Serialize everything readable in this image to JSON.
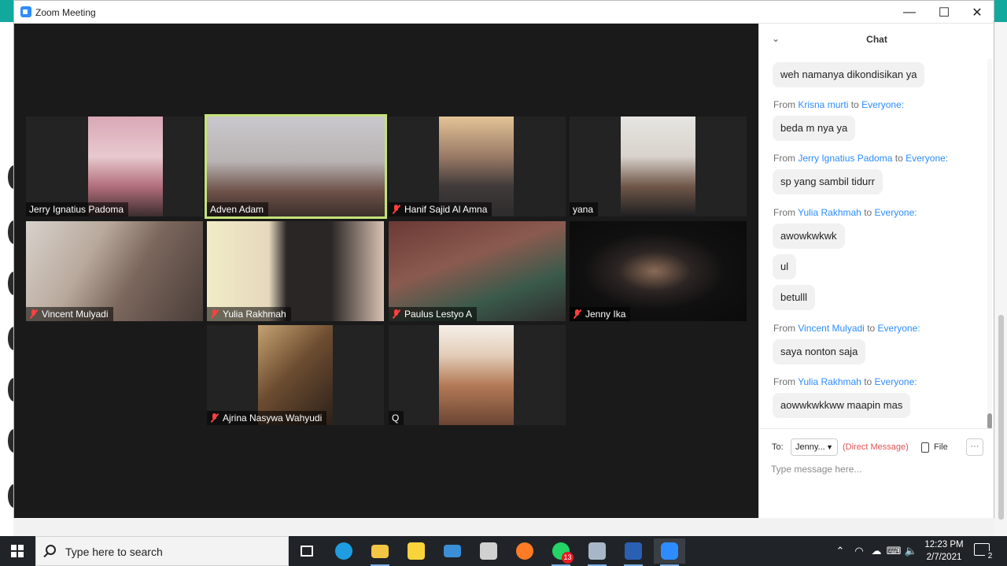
{
  "window": {
    "title": "Zoom Meeting",
    "minimize_glyph": "—",
    "maximize_glyph": "☐",
    "close_glyph": "✕"
  },
  "participants": [
    {
      "name": "Jerry Ignatius Padoma",
      "muted": false,
      "active": false
    },
    {
      "name": "Adven Adam",
      "muted": false,
      "active": true
    },
    {
      "name": "Hanif Sajid Al Amna",
      "muted": true,
      "active": false
    },
    {
      "name": "yana",
      "muted": false,
      "active": false
    },
    {
      "name": "Vincent Mulyadi",
      "muted": true,
      "active": false
    },
    {
      "name": "Yulia Rakhmah",
      "muted": true,
      "active": false
    },
    {
      "name": "Paulus Lestyo A",
      "muted": true,
      "active": false
    },
    {
      "name": "Jenny Ika",
      "muted": true,
      "active": false
    },
    {
      "name": "Ajrina Nasywa Wahyudi",
      "muted": true,
      "active": false
    },
    {
      "name": "Q",
      "muted": false,
      "active": false
    }
  ],
  "chat": {
    "title": "Chat",
    "collapse_glyph": "⌄",
    "from_word": "From",
    "to_word": "to",
    "everyone": "Everyone:",
    "messages": [
      {
        "sender": null,
        "text": "weh namanya dikondisikan ya"
      },
      {
        "sender": "Krisna murti",
        "text": "beda m nya ya"
      },
      {
        "sender": "Jerry Ignatius Padoma",
        "text": "sp yang sambil tidurr"
      },
      {
        "sender": "Yulia Rakhmah",
        "text": "awowkwkwk"
      },
      {
        "sender": null,
        "text": "ul"
      },
      {
        "sender": null,
        "text": "betulll"
      },
      {
        "sender": "Vincent Mulyadi",
        "text": "saya nonton saja"
      },
      {
        "sender": "Yulia Rakhmah",
        "text": "aowwkwkkww maapin mas"
      }
    ],
    "to_label": "To:",
    "recipient": "Jenny...",
    "direct_message": "(Direct Message)",
    "file_label": "File",
    "more_glyph": "···",
    "input_placeholder": "Type message here..."
  },
  "taskbar": {
    "search_placeholder": "Type here to search",
    "apps": [
      {
        "icon": "task-view-icon",
        "color": "#ffffff"
      },
      {
        "icon": "edge-icon",
        "color": "#1f9de0"
      },
      {
        "icon": "file-explorer-icon",
        "color": "#f3c544"
      },
      {
        "icon": "sticky-notes-icon",
        "color": "#f8d43a"
      },
      {
        "icon": "mail-icon",
        "color": "#3a8fd8"
      },
      {
        "icon": "store-icon",
        "color": "#d0d0d0"
      },
      {
        "icon": "firefox-icon",
        "color": "#ff7b25"
      },
      {
        "icon": "whatsapp-icon",
        "color": "#25d366"
      },
      {
        "icon": "photos-icon",
        "color": "#a7b7c7"
      },
      {
        "icon": "word-icon",
        "color": "#2b5fb4"
      },
      {
        "icon": "zoom-icon",
        "color": "#2d8cff"
      }
    ],
    "whatsapp_badge": "13",
    "tray_chevron": "⌃",
    "time": "12:23 PM",
    "date": "2/7/2021",
    "notification_count": "2"
  }
}
